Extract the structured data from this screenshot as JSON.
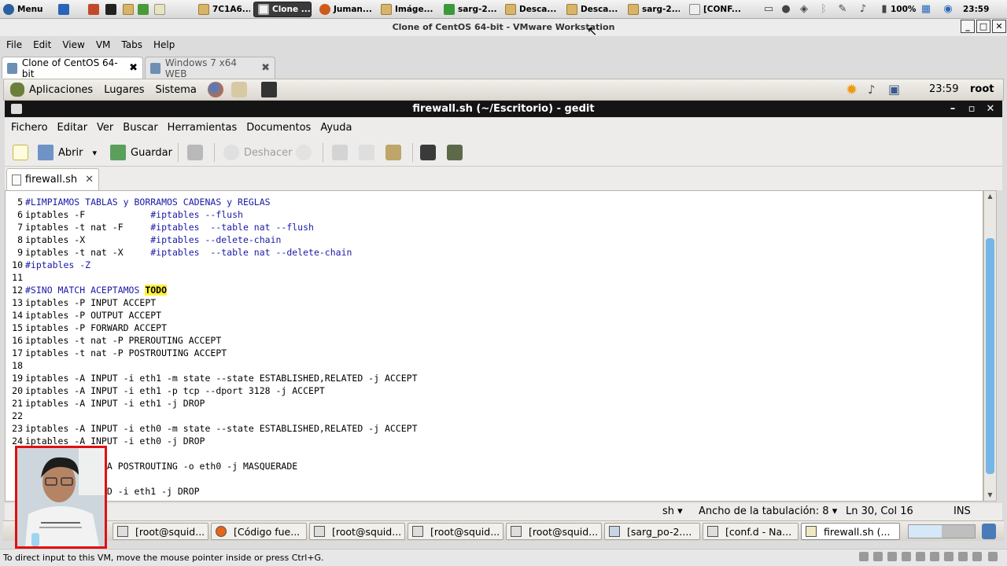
{
  "host": {
    "menu_label": "Menu",
    "tasks": [
      "7C1A6...",
      "Clone ...",
      "Juman...",
      "Imáge...",
      "sarg-2....",
      "Desca...",
      "Desca...",
      "sarg-2....",
      "[CONF..."
    ],
    "battery": "100%",
    "clock": "23:59"
  },
  "vmware": {
    "title": "Clone of CentOS 64-bit - VMware Workstation",
    "menu": [
      "File",
      "Edit",
      "View",
      "VM",
      "Tabs",
      "Help"
    ],
    "tabs": [
      "Clone of CentOS 64-bit",
      "Windows 7 x64 WEB"
    ],
    "status_text": "To direct input to this VM, move the mouse pointer inside or press Ctrl+G."
  },
  "guest_panel": {
    "items": [
      "Aplicaciones",
      "Lugares",
      "Sistema"
    ],
    "clock": "23:59",
    "user": "root"
  },
  "gedit": {
    "title": "firewall.sh (~/Escritorio) - gedit",
    "menu": [
      "Fichero",
      "Editar",
      "Ver",
      "Buscar",
      "Herramientas",
      "Documentos",
      "Ayuda"
    ],
    "toolbar": {
      "open": "Abrir",
      "save": "Guardar",
      "undo": "Deshacer"
    },
    "doc_tab": "firewall.sh",
    "status": {
      "lang": "sh",
      "tab_width": "Ancho de la tabulación: 8",
      "position": "Ln 30, Col 16",
      "mode": "INS"
    }
  },
  "editor": {
    "lines": [
      {
        "n": "5",
        "code": "",
        "comment": "#LIMPIAMOS TABLAS y BORRAMOS CADENAS y REGLAS"
      },
      {
        "n": "6",
        "code": "iptables -F            ",
        "comment": "#iptables --flush"
      },
      {
        "n": "7",
        "code": "iptables -t nat -F     ",
        "comment": "#iptables  --table nat --flush"
      },
      {
        "n": "8",
        "code": "iptables -X            ",
        "comment": "#iptables --delete-chain"
      },
      {
        "n": "9",
        "code": "iptables -t nat -X     ",
        "comment": "#iptables  --table nat --delete-chain"
      },
      {
        "n": "10",
        "code": "",
        "comment": "#iptables -Z"
      },
      {
        "n": "11",
        "code": "",
        "comment": ""
      },
      {
        "n": "12",
        "code": "",
        "comment": "#SINO MATCH ACEPTAMOS ",
        "hl": "TODO"
      },
      {
        "n": "13",
        "code": "iptables -P INPUT ACCEPT",
        "comment": ""
      },
      {
        "n": "14",
        "code": "iptables -P OUTPUT ACCEPT",
        "comment": ""
      },
      {
        "n": "15",
        "code": "iptables -P FORWARD ACCEPT",
        "comment": ""
      },
      {
        "n": "16",
        "code": "iptables -t nat -P PREROUTING ACCEPT",
        "comment": ""
      },
      {
        "n": "17",
        "code": "iptables -t nat -P POSTROUTING ACCEPT",
        "comment": ""
      },
      {
        "n": "18",
        "code": "",
        "comment": ""
      },
      {
        "n": "19",
        "code": "iptables -A INPUT -i eth1 -m state --state ESTABLISHED,RELATED -j ACCEPT",
        "comment": ""
      },
      {
        "n": "20",
        "code": "iptables -A INPUT -i eth1 -p tcp --dport 3128 -j ACCEPT",
        "comment": ""
      },
      {
        "n": "21",
        "code": "iptables -A INPUT -i eth1 -j DROP",
        "comment": ""
      },
      {
        "n": "22",
        "code": "",
        "comment": ""
      },
      {
        "n": "23",
        "code": "iptables -A INPUT -i eth0 -m state --state ESTABLISHED,RELATED -j ACCEPT",
        "comment": ""
      },
      {
        "n": "24",
        "code": "iptables -A INPUT -i eth0 -j DROP",
        "comment": ""
      },
      {
        "n": "2",
        "code": "",
        "comment": ""
      },
      {
        "n": "2",
        "code": "            t -A POSTROUTING -o eth0 -j MASQUERADE",
        "comment": ""
      },
      {
        "n": "2",
        "code": "",
        "comment": ""
      },
      {
        "n": "2",
        "code": "           RWARD -i eth1 -j DROP",
        "comment": ""
      }
    ]
  },
  "guest_tasks": [
    "[root@squid...",
    "[Código fue...",
    "[root@squid...",
    "[root@squid...",
    "[root@squid...",
    "[sarg_po-2....",
    "[conf.d - Na...",
    "firewall.sh (..."
  ]
}
